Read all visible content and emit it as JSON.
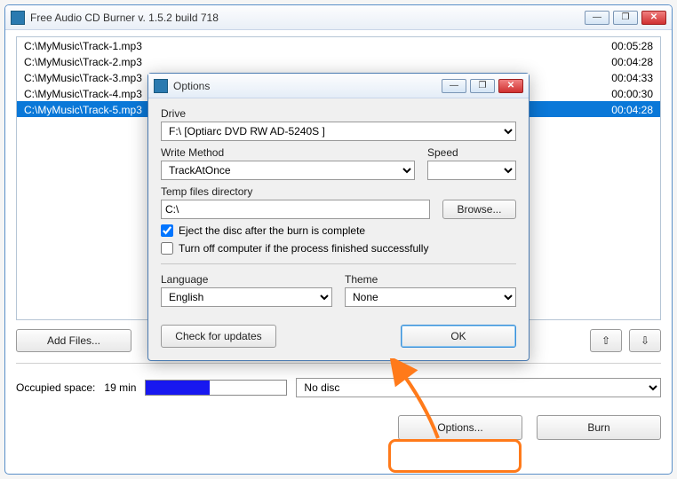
{
  "main": {
    "title": "Free Audio CD Burner  v. 1.5.2 build 718",
    "tracks": [
      {
        "path": "C:\\MyMusic\\Track-1.mp3",
        "duration": "00:05:28",
        "selected": false
      },
      {
        "path": "C:\\MyMusic\\Track-2.mp3",
        "duration": "00:04:28",
        "selected": false
      },
      {
        "path": "C:\\MyMusic\\Track-3.mp3",
        "duration": "00:04:33",
        "selected": false
      },
      {
        "path": "C:\\MyMusic\\Track-4.mp3",
        "duration": "00:00:30",
        "selected": false
      },
      {
        "path": "C:\\MyMusic\\Track-5.mp3",
        "duration": "00:04:28",
        "selected": true
      }
    ],
    "add_files_label": "Add Files...",
    "up_glyph": "⇧",
    "down_glyph": "⇩",
    "occupied_label": "Occupied space:",
    "occupied_value": "19 min",
    "disc_value": "No disc",
    "options_label": "Options...",
    "burn_label": "Burn"
  },
  "dialog": {
    "title": "Options",
    "drive_label": "Drive",
    "drive_value": "F:\\ [Optiarc DVD RW AD-5240S ]",
    "write_method_label": "Write Method",
    "write_method_value": "TrackAtOnce",
    "speed_label": "Speed",
    "speed_value": "",
    "temp_label": "Temp files directory",
    "temp_value": "C:\\",
    "browse_label": "Browse...",
    "eject_label": "Eject the disc after the burn is complete",
    "eject_checked": true,
    "turnoff_label": "Turn off computer if the process finished successfully",
    "turnoff_checked": false,
    "language_label": "Language",
    "language_value": "English",
    "theme_label": "Theme",
    "theme_value": "None",
    "check_updates_label": "Check for updates",
    "ok_label": "OK"
  },
  "win_controls": {
    "min": "—",
    "max": "❐",
    "close": "✕"
  }
}
